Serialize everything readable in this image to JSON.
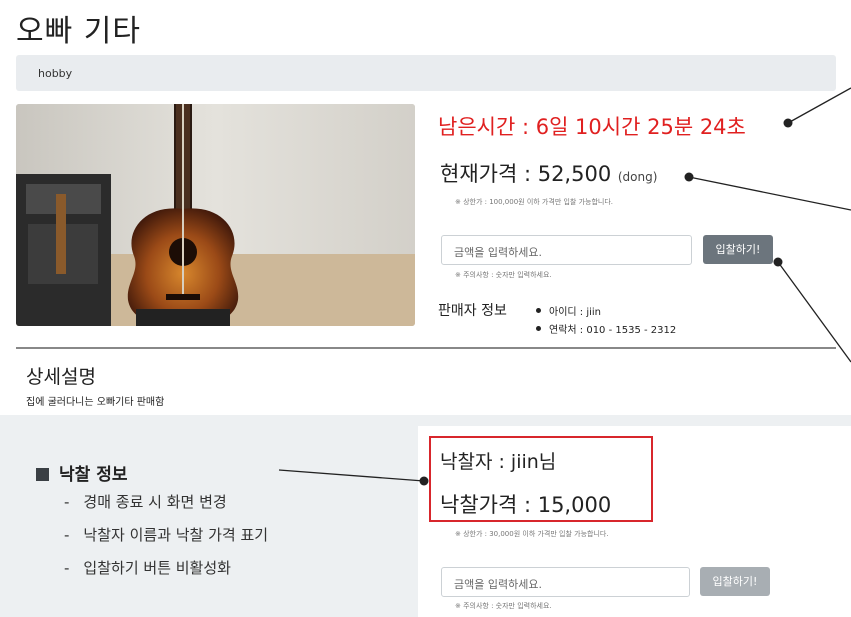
{
  "header": {
    "title": "오빠 기타",
    "breadcrumb": "hobby"
  },
  "auction": {
    "remaining_time": "남은시간 : 6일 10시간 25분 24초",
    "current_price_label": "현재가격 : 52,500",
    "currency": "(dong)",
    "max_note": "※ 상한가 : 100,000원 이하 가격만 입찰 가능합니다.",
    "bid_placeholder": "금액을 입력하세요.",
    "bid_button": "입찰하기!",
    "input_note": "※ 주의사항 : 숫자만 입력하세요."
  },
  "seller": {
    "label": "판매자 정보",
    "items": [
      "아이디 : jiin",
      "연락처 : 010 - 1535 - 2312"
    ]
  },
  "detail": {
    "title": "상세설명",
    "text": "집에 굴러다니는 오빠기타 판매함"
  },
  "winning_info": {
    "heading": "낙찰 정보",
    "bullets": [
      "경매 종료 시 화면 변경",
      "낙찰자 이름과 낙찰 가격 표기",
      "입찰하기 버튼 비활성화"
    ]
  },
  "closed_view": {
    "winner": "낙찰자 : jiin님",
    "winning_price": "낙찰가격 : 15,000",
    "max_note": "※ 상한가 : 30,000원 이하 가격만 입찰 가능합니다.",
    "bid_placeholder": "금액을 입력하세요.",
    "bid_button": "입찰하기!",
    "input_note": "※ 주의사항 : 숫자만 입력하세요."
  },
  "colors": {
    "accent_red": "#e02020",
    "button_active": "#6c757d",
    "button_disabled": "#a8aeb3",
    "highlight_border": "#d8262c"
  }
}
